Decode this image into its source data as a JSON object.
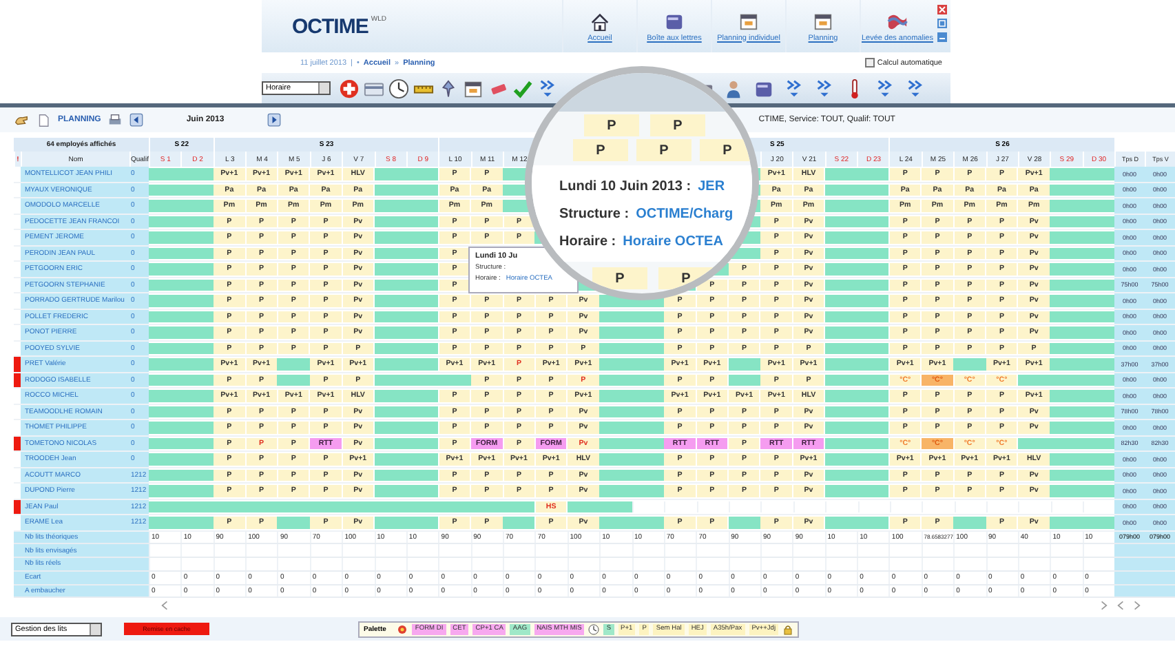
{
  "app": {
    "logo": "OCTIME",
    "logo_suffix": "WLD"
  },
  "nav": [
    {
      "label": "Accueil"
    },
    {
      "label": "Boîte aux lettres"
    },
    {
      "label": "Planning individuel"
    },
    {
      "label": "Planning"
    },
    {
      "label": "Levée des anomalies"
    }
  ],
  "breadcrumb": {
    "date": "11 juillet 2013",
    "separator": "|",
    "links": [
      {
        "prefix": "•",
        "label": "Accueil"
      },
      {
        "prefix": "»",
        "label": "Planning"
      }
    ]
  },
  "auto_calc": {
    "label": "Calcul automatique",
    "checked": false
  },
  "toolbar": {
    "view_select": "Horaire"
  },
  "planning": {
    "title": "PLANNING",
    "month": "Juin 2013",
    "filter": "CTIME, Service: TOUT, Qualif: TOUT",
    "employee_count": "64 employés affichés",
    "weeks": [
      {
        "label": "S 22"
      },
      {
        "label": "S 23"
      },
      {
        "label": "S 25"
      },
      {
        "label": "S 26"
      }
    ],
    "columns": {
      "flag": "!",
      "name": "Nom",
      "qualif": "Qualif",
      "totals": [
        "Tps D",
        "Tps V"
      ]
    },
    "days": [
      {
        "label": "S 1",
        "weekend": true
      },
      {
        "label": "D 2",
        "weekend": true
      },
      {
        "label": "L 3",
        "weekend": false
      },
      {
        "label": "M 4",
        "weekend": false
      },
      {
        "label": "M 5",
        "weekend": false
      },
      {
        "label": "J 6",
        "weekend": false
      },
      {
        "label": "V 7",
        "weekend": false
      },
      {
        "label": "S 8",
        "weekend": true
      },
      {
        "label": "D 9",
        "weekend": true
      },
      {
        "label": "L 10",
        "weekend": false
      },
      {
        "label": "M 11",
        "weekend": false
      },
      {
        "label": "M 12",
        "weekend": false
      },
      {
        "label": "J 20",
        "weekend": false
      },
      {
        "label": "V 21",
        "weekend": false
      },
      {
        "label": "S 22",
        "weekend": true
      },
      {
        "label": "D 23",
        "weekend": true
      },
      {
        "label": "L 24",
        "weekend": false
      },
      {
        "label": "M 25",
        "weekend": false
      },
      {
        "label": "M 26",
        "weekend": false
      },
      {
        "label": "J 27",
        "weekend": false
      },
      {
        "label": "V 28",
        "weekend": false
      },
      {
        "label": "S 29",
        "weekend": true
      },
      {
        "label": "D 30",
        "weekend": true
      }
    ],
    "rows": [
      {
        "name": "MONTELLICOT JEAN PHILI",
        "qualif": "0",
        "flagged": false,
        "totals": [
          "0h00",
          "0h00"
        ],
        "cells": [
          null,
          null,
          "Pv+1",
          "Pv+1",
          "Pv+1",
          "Pv+1",
          "HLV",
          null,
          null,
          "P",
          "P",
          null,
          null,
          null,
          null,
          null,
          null,
          null,
          null,
          "Pv+1",
          "HLV",
          null,
          null,
          "P",
          "P",
          "P",
          "P",
          "Pv+1",
          null,
          null
        ]
      },
      {
        "name": "MYAUX VERONIQUE",
        "qualif": "0",
        "flagged": false,
        "totals": [
          "0h00",
          "0h00"
        ],
        "cells": [
          null,
          null,
          "Pa",
          "Pa",
          "Pa",
          "Pa",
          "Pa",
          null,
          null,
          "Pa",
          "Pa",
          null,
          null,
          null,
          null,
          null,
          null,
          null,
          null,
          "Pa",
          "Pa",
          null,
          null,
          "Pa",
          "Pa",
          "Pa",
          "Pa",
          "Pa",
          null,
          null
        ]
      },
      {
        "name": "OMODOLO MARCELLE",
        "qualif": "0",
        "flagged": false,
        "totals": [
          "0h00",
          "0h00"
        ],
        "cells": [
          null,
          null,
          "Pm",
          "Pm",
          "Pm",
          "Pm",
          "Pm",
          null,
          null,
          "Pm",
          "Pm",
          null,
          null,
          null,
          null,
          null,
          null,
          null,
          null,
          "Pm",
          "Pm",
          null,
          null,
          "Pm",
          "Pm",
          "Pm",
          "Pm",
          "Pm",
          null,
          null
        ]
      },
      {
        "name": "PEDOCETTE JEAN FRANCOI",
        "qualif": "0",
        "flagged": false,
        "totals": [
          "0h00",
          "0h00"
        ],
        "cells": [
          null,
          null,
          "P",
          "P",
          "P",
          "P",
          "Pv",
          null,
          null,
          "P",
          "P",
          "P",
          null,
          null,
          null,
          null,
          null,
          null,
          null,
          "P",
          "Pv",
          null,
          null,
          "P",
          "P",
          "P",
          "P",
          "Pv",
          null,
          null
        ]
      },
      {
        "name": "PEMENT JEROME",
        "qualif": "0",
        "flagged": false,
        "totals": [
          "0h00",
          "0h00"
        ],
        "cells": [
          null,
          null,
          "P",
          "P",
          "P",
          "P",
          "Pv",
          null,
          null,
          "P",
          "P",
          "P",
          null,
          null,
          null,
          null,
          null,
          null,
          null,
          "P",
          "Pv",
          null,
          null,
          "P",
          "P",
          "P",
          "P",
          "Pv",
          null,
          null
        ]
      },
      {
        "name": "PERODIN JEAN PAUL",
        "qualif": "0",
        "flagged": false,
        "totals": [
          "0h00",
          "0h00"
        ],
        "cells": [
          null,
          null,
          "P",
          "P",
          "P",
          "P",
          "Pv",
          null,
          null,
          "P",
          null,
          null,
          null,
          null,
          null,
          null,
          null,
          null,
          null,
          "P",
          "Pv",
          null,
          null,
          "P",
          "P",
          "P",
          "P",
          "Pv",
          null,
          null
        ]
      },
      {
        "name": "PETGOORN ERIC",
        "qualif": "0",
        "flagged": false,
        "totals": [
          "0h00",
          "0h00"
        ],
        "cells": [
          null,
          null,
          "P",
          "P",
          "P",
          "P",
          "Pv",
          null,
          null,
          "P",
          null,
          null,
          null,
          null,
          null,
          null,
          null,
          null,
          "P",
          "P",
          "Pv",
          null,
          null,
          "P",
          "P",
          "P",
          "P",
          "Pv",
          null,
          null
        ]
      },
      {
        "name": "PETGOORN STEPHANIE",
        "qualif": "0",
        "flagged": false,
        "totals": [
          "75h00",
          "75h00"
        ],
        "cells": [
          null,
          null,
          "P",
          "P",
          "P",
          "P",
          "Pv",
          null,
          null,
          "P",
          null,
          null,
          null,
          null,
          null,
          null,
          null,
          "P",
          "P",
          "P",
          "Pv",
          null,
          null,
          "P",
          "P",
          "P",
          "P",
          "Pv",
          null,
          null
        ]
      },
      {
        "name": "PORRADO GERTRUDE Marilou",
        "qualif": "0",
        "flagged": false,
        "totals": [
          "0h00",
          "0h00"
        ],
        "cells": [
          null,
          null,
          "P",
          "P",
          "P",
          "P",
          "Pv",
          null,
          null,
          "P",
          "P",
          "P",
          "P",
          "Pv",
          null,
          null,
          "P",
          "P",
          "P",
          "P",
          "Pv",
          null,
          null,
          "P",
          "P",
          "P",
          "P",
          "Pv",
          null,
          null
        ]
      },
      {
        "name": "POLLET FREDERIC",
        "qualif": "0",
        "flagged": false,
        "totals": [
          "0h00",
          "0h00"
        ],
        "cells": [
          null,
          null,
          "P",
          "P",
          "P",
          "P",
          "Pv",
          null,
          null,
          "P",
          "P",
          "P",
          "P",
          "Pv",
          null,
          null,
          "P",
          "P",
          "P",
          "P",
          "Pv",
          null,
          null,
          "P",
          "P",
          "P",
          "P",
          "Pv",
          null,
          null
        ]
      },
      {
        "name": "PONOT PIERRE",
        "qualif": "0",
        "flagged": false,
        "totals": [
          "0h00",
          "0h00"
        ],
        "cells": [
          null,
          null,
          "P",
          "P",
          "P",
          "P",
          "Pv",
          null,
          null,
          "P",
          "P",
          "P",
          "P",
          "Pv",
          null,
          null,
          "P",
          "P",
          "P",
          "P",
          "Pv",
          null,
          null,
          "P",
          "P",
          "P",
          "P",
          "Pv",
          null,
          null
        ]
      },
      {
        "name": "POOYED SYLVIE",
        "qualif": "0",
        "flagged": false,
        "totals": [
          "0h00",
          "0h00"
        ],
        "cells": [
          null,
          null,
          "P",
          "P",
          "P",
          "P",
          "P",
          null,
          null,
          "P",
          "P",
          "P",
          "P",
          "P",
          null,
          null,
          "P",
          "P",
          "P",
          "P",
          "P",
          null,
          null,
          "P",
          "P",
          "P",
          "P",
          "P",
          null,
          null
        ]
      },
      {
        "name": "PRET Valérie",
        "qualif": "0",
        "flagged": true,
        "totals": [
          "37h00",
          "37h00"
        ],
        "cells": [
          null,
          null,
          "Pv+1",
          "Pv+1",
          null,
          "Pv+1",
          "Pv+1",
          null,
          null,
          "Pv+1",
          "Pv+1",
          {
            "text": "P",
            "kind": "conflict"
          },
          "Pv+1",
          "Pv+1",
          null,
          null,
          "Pv+1",
          "Pv+1",
          null,
          "Pv+1",
          "Pv+1",
          null,
          null,
          "Pv+1",
          "Pv+1",
          null,
          "Pv+1",
          "Pv+1",
          null,
          null
        ]
      },
      {
        "name": "RODOGO ISABELLE",
        "qualif": "0",
        "flagged": true,
        "totals": [
          "0h00",
          "0h00"
        ],
        "cells": [
          null,
          null,
          "P",
          "P",
          null,
          "P",
          "P",
          null,
          null,
          null,
          "P",
          "P",
          "P",
          {
            "text": "P",
            "kind": "conflict"
          },
          null,
          null,
          "P",
          "P",
          null,
          "P",
          "P",
          null,
          null,
          {
            "text": "°C°",
            "kind": "alert"
          },
          {
            "text": "°C°",
            "kind": "urgent"
          },
          {
            "text": "°C°",
            "kind": "alert"
          },
          {
            "text": "°C°",
            "kind": "alert"
          },
          null,
          null,
          null
        ]
      },
      {
        "name": "ROCCO MICHEL",
        "qualif": "0",
        "flagged": false,
        "totals": [
          "0h00",
          "0h00"
        ],
        "cells": [
          null,
          null,
          "Pv+1",
          "Pv+1",
          "Pv+1",
          "Pv+1",
          "HLV",
          null,
          null,
          "P",
          "P",
          "P",
          "P",
          "Pv+1",
          null,
          null,
          "Pv+1",
          "Pv+1",
          "Pv+1",
          "Pv+1",
          "HLV",
          null,
          null,
          "P",
          "P",
          "P",
          "P",
          "Pv+1",
          null,
          null
        ]
      },
      {
        "name": "TEAMOODLHE ROMAIN",
        "qualif": "0",
        "flagged": false,
        "totals": [
          "78h00",
          "78h00"
        ],
        "cells": [
          null,
          null,
          "P",
          "P",
          "P",
          "P",
          "Pv",
          null,
          null,
          "P",
          "P",
          "P",
          "P",
          "Pv",
          null,
          null,
          "P",
          "P",
          "P",
          "P",
          "Pv",
          null,
          null,
          "P",
          "P",
          "P",
          "P",
          "Pv",
          null,
          null
        ]
      },
      {
        "name": "THOMET PHILIPPE",
        "qualif": "0",
        "flagged": false,
        "totals": [
          "0h00",
          "0h00"
        ],
        "cells": [
          null,
          null,
          "P",
          "P",
          "P",
          "P",
          "Pv",
          null,
          null,
          "P",
          "P",
          "P",
          "P",
          "Pv",
          null,
          null,
          "P",
          "P",
          "P",
          "P",
          "Pv",
          null,
          null,
          "P",
          "P",
          "P",
          "P",
          "Pv",
          null,
          null
        ]
      },
      {
        "name": "TOMETONO NICOLAS",
        "qualif": "0",
        "flagged": true,
        "totals": [
          "82h30",
          "82h30"
        ],
        "cells": [
          null,
          null,
          "P",
          {
            "text": "P",
            "kind": "conflict"
          },
          "P",
          {
            "text": "RTT",
            "kind": "highlight"
          },
          "Pv",
          null,
          null,
          "P",
          {
            "text": "FORM",
            "kind": "highlight"
          },
          "P",
          {
            "text": "FORM",
            "kind": "highlight"
          },
          {
            "text": "Pv",
            "kind": "conflict"
          },
          null,
          null,
          {
            "text": "RTT",
            "kind": "highlight"
          },
          {
            "text": "RTT",
            "kind": "highlight"
          },
          "P",
          {
            "text": "RTT",
            "kind": "highlight"
          },
          {
            "text": "RTT",
            "kind": "highlight"
          },
          null,
          null,
          {
            "text": "°C°",
            "kind": "alert"
          },
          {
            "text": "°C°",
            "kind": "urgent"
          },
          {
            "text": "°C°",
            "kind": "alert"
          },
          {
            "text": "°C°",
            "kind": "alert"
          },
          null,
          null,
          null
        ]
      },
      {
        "name": "TROODEH Jean",
        "qualif": "0",
        "flagged": false,
        "totals": [
          "0h00",
          "0h00"
        ],
        "cells": [
          null,
          null,
          "P",
          "P",
          "P",
          "P",
          "Pv+1",
          null,
          null,
          "Pv+1",
          "Pv+1",
          "Pv+1",
          "Pv+1",
          "HLV",
          null,
          null,
          "P",
          "P",
          "P",
          "P",
          "Pv+1",
          null,
          null,
          "Pv+1",
          "Pv+1",
          "Pv+1",
          "Pv+1",
          "HLV",
          null,
          null
        ]
      },
      {
        "name": "ACOUTT MARCO",
        "qualif": "1212",
        "flagged": false,
        "totals": [
          "0h00",
          "0h00"
        ],
        "cells": [
          null,
          null,
          "P",
          "P",
          "P",
          "P",
          "Pv",
          null,
          null,
          "P",
          "P",
          "P",
          "P",
          "Pv",
          null,
          null,
          "P",
          "P",
          "P",
          "P",
          "Pv",
          null,
          null,
          "P",
          "P",
          "P",
          "P",
          "Pv",
          null,
          null
        ]
      },
      {
        "name": "DUPOND Pierre",
        "qualif": "1212",
        "flagged": false,
        "totals": [
          "0h00",
          "0h00"
        ],
        "cells": [
          null,
          null,
          "P",
          "P",
          "P",
          "P",
          "Pv",
          null,
          null,
          "P",
          "P",
          "P",
          "P",
          "Pv",
          null,
          null,
          "P",
          "P",
          "P",
          "P",
          "Pv",
          null,
          null,
          "P",
          "P",
          "P",
          "P",
          "Pv",
          null,
          null
        ]
      },
      {
        "name": "JEAN Paul",
        "qualif": "1212",
        "flagged": true,
        "totals": [
          "0h00",
          "0h00"
        ],
        "cells": [
          null,
          null,
          null,
          null,
          null,
          null,
          null,
          null,
          null,
          null,
          null,
          null,
          {
            "text": "HS",
            "kind": "conflict"
          },
          null,
          null,
          {
            "kind": "empty"
          },
          {
            "kind": "empty"
          },
          {
            "kind": "empty"
          },
          {
            "kind": "empty"
          },
          {
            "kind": "empty"
          },
          {
            "kind": "empty"
          },
          {
            "kind": "empty"
          },
          {
            "kind": "empty"
          },
          {
            "kind": "empty"
          },
          {
            "kind": "empty"
          },
          {
            "kind": "empty"
          },
          {
            "kind": "empty"
          },
          {
            "kind": "empty"
          },
          {
            "kind": "empty"
          },
          {
            "kind": "empty"
          }
        ]
      },
      {
        "name": "ERAME Lea",
        "qualif": "1212",
        "flagged": false,
        "totals": [
          "0h00",
          "0h00"
        ],
        "cells": [
          null,
          null,
          "P",
          "P",
          null,
          "P",
          "Pv",
          null,
          null,
          "P",
          "P",
          null,
          "P",
          "Pv",
          null,
          null,
          "P",
          "P",
          null,
          "P",
          "Pv",
          null,
          null,
          "P",
          "P",
          null,
          "P",
          "Pv",
          null,
          null
        ]
      }
    ],
    "summary": [
      {
        "label": "Nb lits théoriques",
        "values": [
          "10",
          "10",
          "90",
          "100",
          "90",
          "70",
          "100",
          "10",
          "10",
          "90",
          "90",
          "70",
          "70",
          "100",
          "10",
          "10",
          "70",
          "70",
          "90",
          "90",
          "90",
          "10",
          "10",
          "100",
          "78.6583277",
          "100",
          "90",
          "40",
          "10",
          "10"
        ],
        "totals": [
          "079h00",
          "079h00"
        ]
      },
      {
        "label": "Nb lits envisagés"
      },
      {
        "label": "Nb lits réels"
      },
      {
        "label": "Ecart",
        "values": [
          "0",
          "0",
          "0",
          "0",
          "0",
          "0",
          "0",
          "0",
          "0",
          "0",
          "0",
          "0",
          "0",
          "0",
          "0",
          "0",
          "0",
          "0",
          "0",
          "0",
          "0",
          "0",
          "0",
          "0",
          "0",
          "0",
          "0",
          "0",
          "0",
          "0"
        ]
      },
      {
        "label": "A embaucher",
        "values": [
          "0",
          "0",
          "0",
          "0",
          "0",
          "0",
          "0",
          "0",
          "0",
          "0",
          "0",
          "0",
          "0",
          "0",
          "0",
          "0",
          "0",
          "0",
          "0",
          "0",
          "0",
          "0",
          "0",
          "0",
          "0",
          "0",
          "0",
          "0",
          "0",
          "0"
        ]
      }
    ]
  },
  "tooltip": {
    "title": "Lundi 10 Ju",
    "structure_label": "Structure :",
    "horaire_label": "Horaire :",
    "horaire": "Horaire OCTEA"
  },
  "magnifier": {
    "top_cells": [
      "P",
      "P"
    ],
    "middle_cells": [
      "P",
      "P",
      "P"
    ],
    "date": "Lundi 10 Juin 2013 :",
    "employee": "JER",
    "structure_label": "Structure :",
    "structure": "OCTIME/Charg",
    "horaire_label": "Horaire :",
    "horaire": "Horaire OCTEA",
    "bottom_cells": [
      "P",
      "P"
    ]
  },
  "footer": {
    "select": "Gestion des lits",
    "alert_button": "Remise en cache",
    "palette_title": "Palette",
    "palette": [
      {
        "label": "FORM DI",
        "color": "#f7a8ef"
      },
      {
        "label": "CET",
        "color": "#f7a8ef"
      },
      {
        "label": "CP+1 CA",
        "color": "#f7a8ef"
      },
      {
        "label": "AAG",
        "color": "#9fe8c8"
      },
      {
        "label": "NAIS MTH MIS",
        "color": "#f7a8ef"
      },
      {
        "label": "S",
        "color": "#9fe8c8"
      },
      {
        "label": "P+1",
        "color": "#fdf3c0"
      },
      {
        "label": "P",
        "color": "#fdf3c0"
      },
      {
        "label": "Sem Hal",
        "color": "#fdf3c0"
      },
      {
        "label": "HEJ",
        "color": "#fdf3c0"
      },
      {
        "label": "A35h/Pax",
        "color": "#fdf3c0"
      },
      {
        "label": "Pv++Jdj",
        "color": "#fdf3c0"
      }
    ]
  }
}
